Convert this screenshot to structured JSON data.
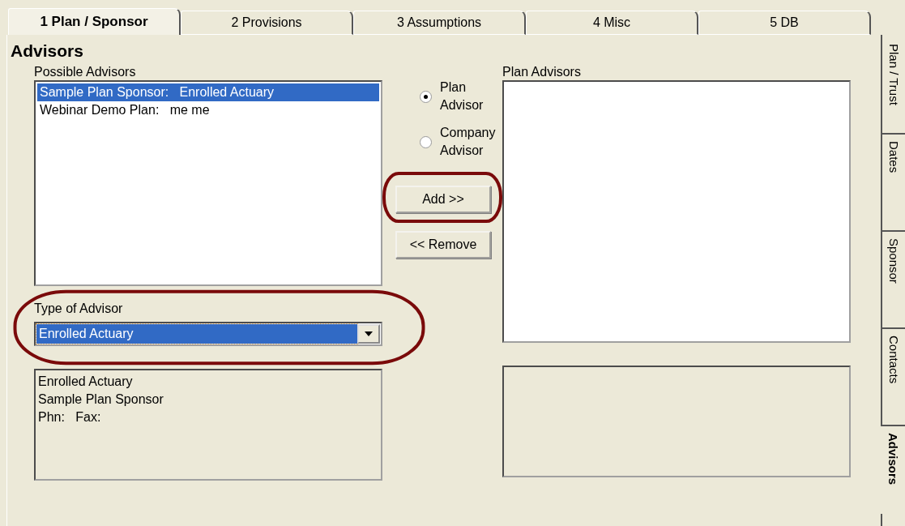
{
  "top_tabs": [
    {
      "label": "1 Plan / Sponsor",
      "selected": true
    },
    {
      "label": "2 Provisions",
      "selected": false
    },
    {
      "label": "3 Assumptions",
      "selected": false
    },
    {
      "label": "4 Misc",
      "selected": false
    },
    {
      "label": "5 DB",
      "selected": false
    }
  ],
  "section_title": "Advisors",
  "possible_advisors": {
    "label": "Possible Advisors",
    "items": [
      {
        "text": "Sample Plan Sponsor:   Enrolled Actuary",
        "selected": true
      },
      {
        "text": "Webinar Demo Plan:   me me",
        "selected": false
      }
    ]
  },
  "advisor_scope": [
    {
      "label": "Plan Advisor",
      "selected": true
    },
    {
      "label": "Company Advisor",
      "selected": false
    }
  ],
  "buttons": [
    {
      "label": "Add >>",
      "highlighted": true
    },
    {
      "label": "<< Remove",
      "highlighted": false
    }
  ],
  "type_of_advisor": {
    "label": "Type of Advisor",
    "value": "Enrolled Actuary",
    "highlighted": true
  },
  "advisor_details": [
    "Enrolled Actuary",
    "Sample Plan Sponsor",
    "Phn:   Fax:"
  ],
  "plan_advisors": {
    "label": "Plan Advisors"
  },
  "side_tabs": [
    {
      "label": "Plan / Trust",
      "selected": false
    },
    {
      "label": "Dates",
      "selected": false
    },
    {
      "label": "Sponsor",
      "selected": false
    },
    {
      "label": "Contacts",
      "selected": false
    },
    {
      "label": "Advisors",
      "selected": true
    }
  ]
}
